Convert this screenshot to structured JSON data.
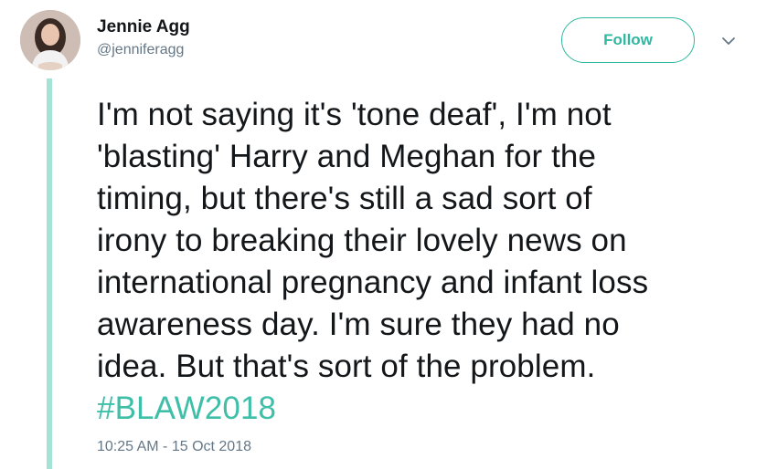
{
  "author": {
    "name": "Jennie Agg",
    "handle": "@jenniferagg"
  },
  "follow_button": {
    "label": "Follow"
  },
  "more_menu": {
    "icon": "chevron-down-icon"
  },
  "tweet": {
    "lines": [
      "I'm not saying it's 'tone deaf', I'm not",
      "'blasting' Harry and Meghan for the",
      "timing, but there's still a sad sort of",
      "irony to breaking their lovely news on",
      "international pregnancy and infant loss",
      "awareness day. I'm sure they had no",
      "idea. But that's sort of the problem."
    ],
    "hashtag": "#BLAW2018",
    "timestamp": "10:25 AM - 15 Oct 2018"
  },
  "colors": {
    "accent": "#2fb8a1",
    "thread_line": "#a5e3d6",
    "text": "#14171a",
    "secondary_text": "#657786"
  }
}
